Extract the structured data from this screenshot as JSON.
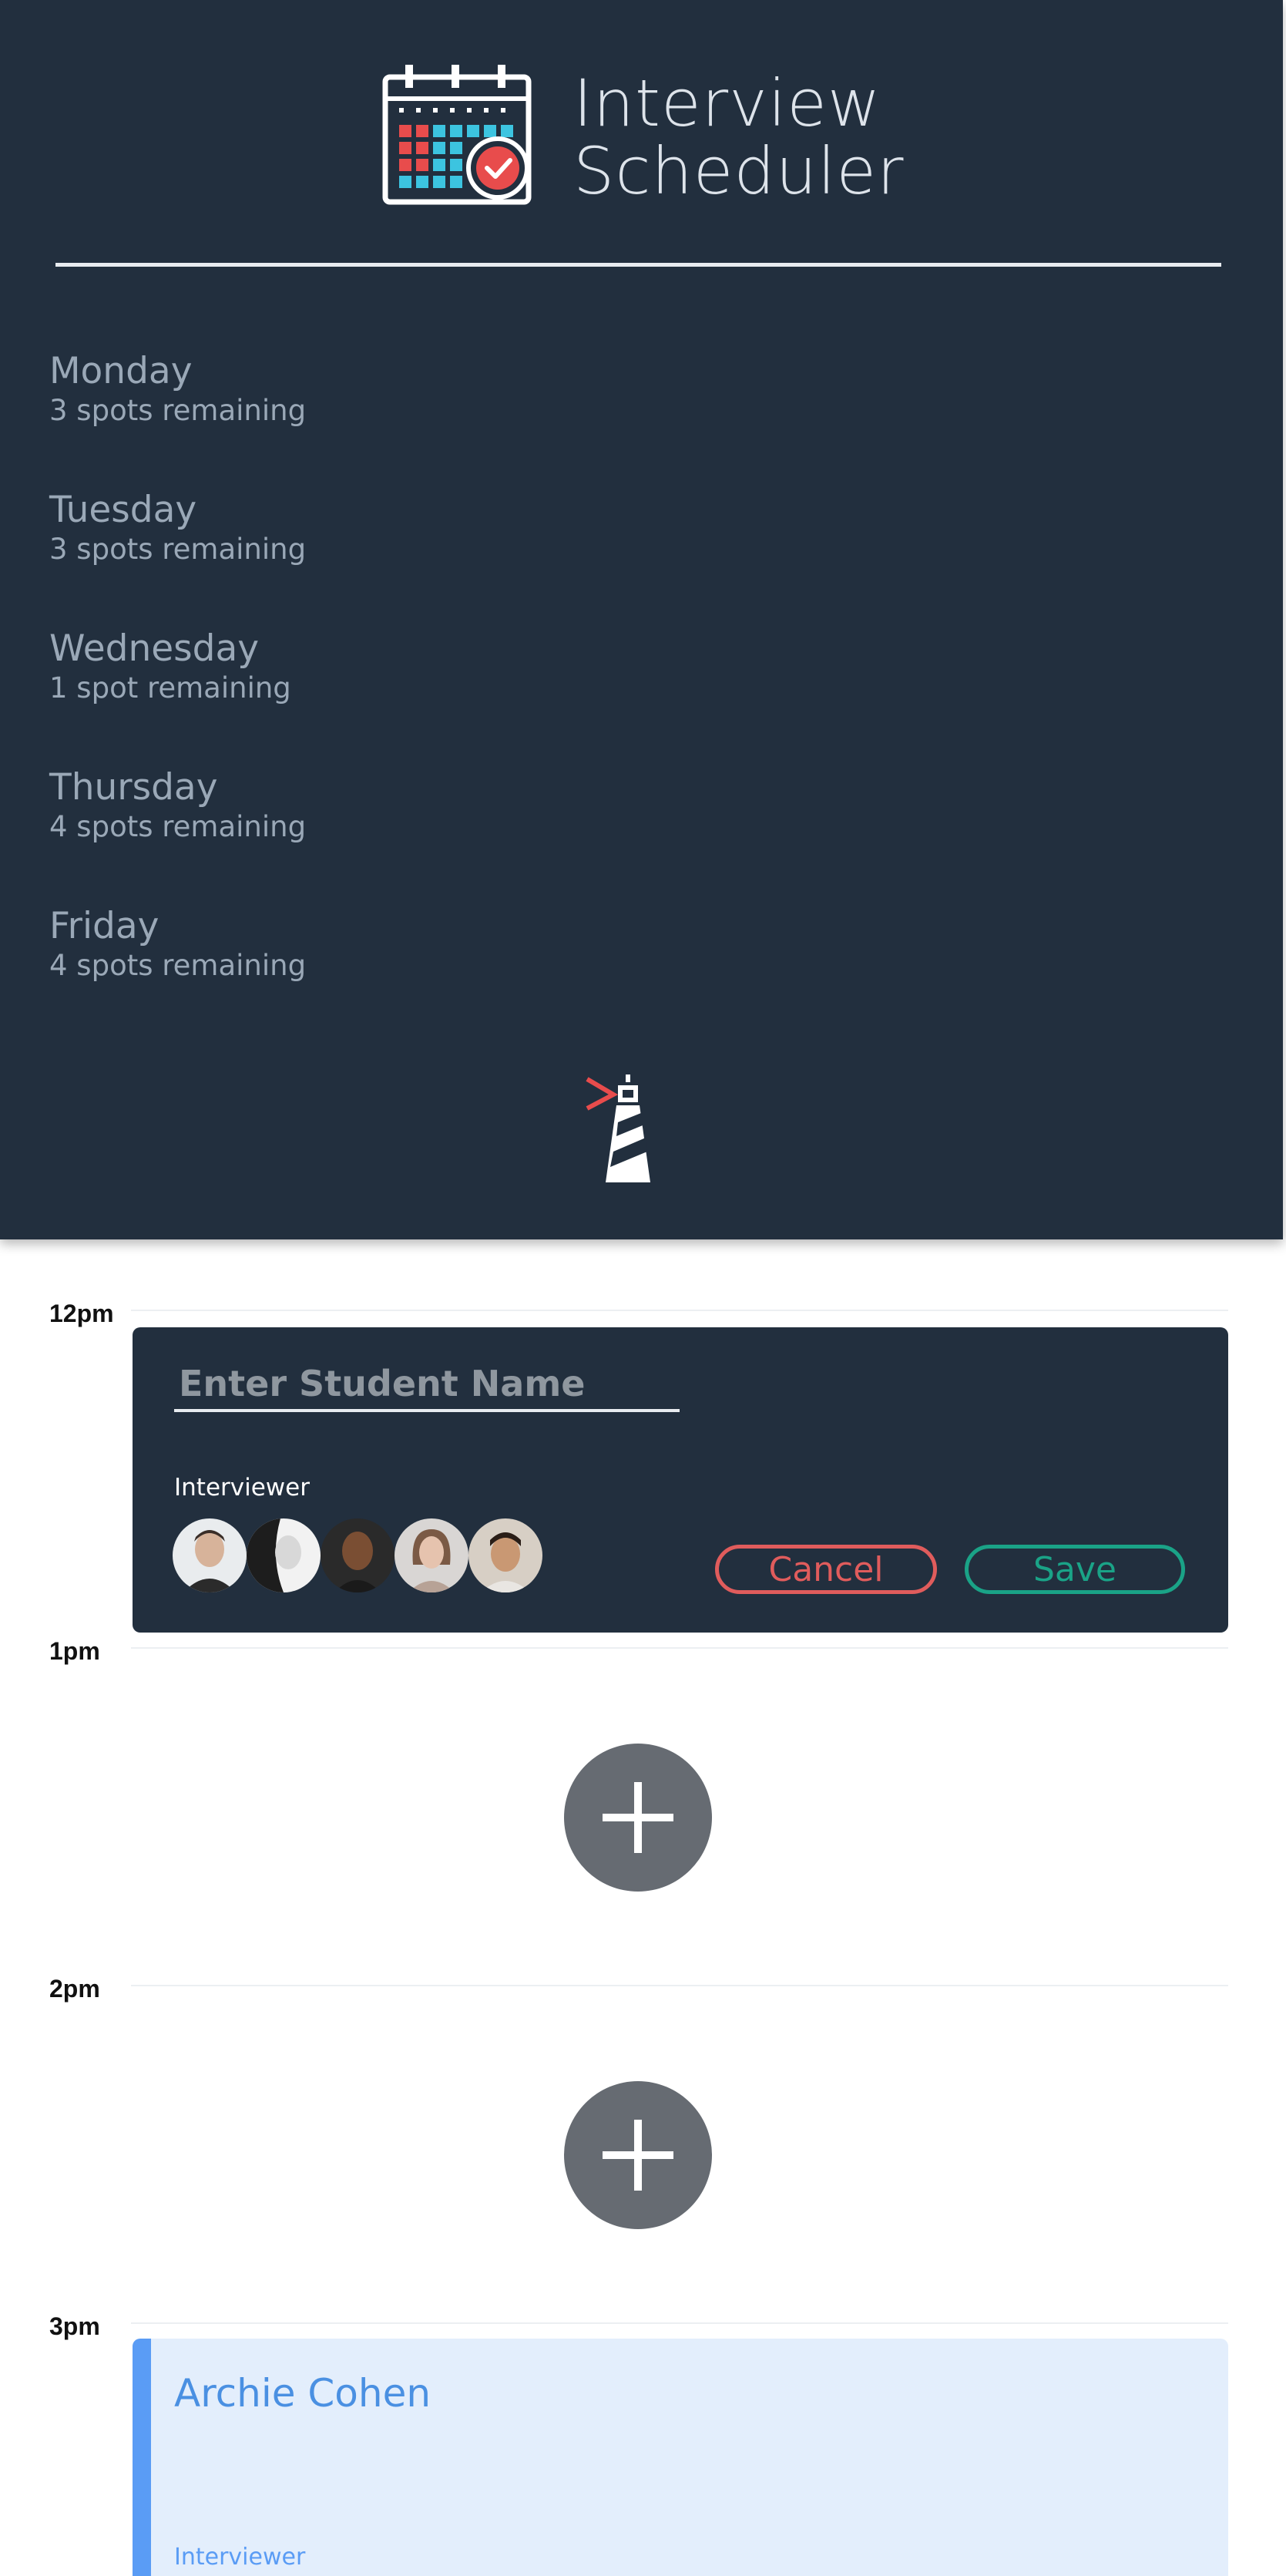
{
  "app": {
    "title_line1": "Interview",
    "title_line2": "Scheduler",
    "logo_icon": "calendar-check-icon",
    "brand_icon": "lighthouse-icon"
  },
  "days": [
    {
      "name": "Monday",
      "spots": "3 spots remaining"
    },
    {
      "name": "Tuesday",
      "spots": "3 spots remaining"
    },
    {
      "name": "Wednesday",
      "spots": "1 spot remaining"
    },
    {
      "name": "Thursday",
      "spots": "4 spots remaining"
    },
    {
      "name": "Friday",
      "spots": "4 spots remaining"
    }
  ],
  "schedule": {
    "times": [
      "12pm",
      "1pm",
      "2pm",
      "3pm"
    ],
    "form": {
      "name_placeholder": "Enter Student Name",
      "name_value": "",
      "interviewer_label": "Interviewer",
      "interviewers": [
        "avatar-1",
        "avatar-2",
        "avatar-3",
        "avatar-4",
        "avatar-5"
      ],
      "cancel_label": "Cancel",
      "save_label": "Save"
    },
    "add_icon": "plus-icon",
    "appointment": {
      "student": "Archie Cohen",
      "interviewer_label": "Interviewer"
    }
  },
  "colors": {
    "sidebar_bg": "#222f3e",
    "day_text": "#9aa8b7",
    "cancel": "#e05c5c",
    "save": "#1aa387",
    "add_button": "#666b72",
    "appointment_bg": "#e3eefc",
    "appointment_accent": "#5a9cf5"
  }
}
